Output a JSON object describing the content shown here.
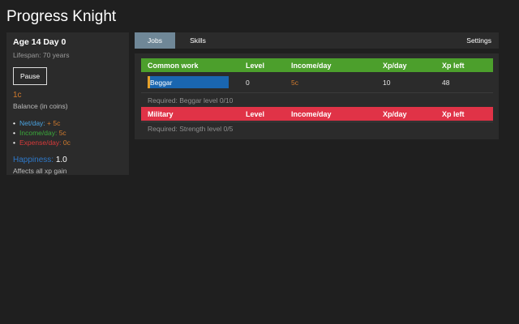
{
  "app": {
    "title": "Progress Knight"
  },
  "sidebar": {
    "age": "Age 14 Day 0",
    "lifespan": "Lifespan: 70 years",
    "pause_label": "Pause",
    "balance": {
      "value": "1c",
      "label": "Balance (in coins)"
    },
    "money": {
      "net_label": "Net/day:",
      "net_value": "+ 5c",
      "income_label": "Income/day:",
      "income_value": "5c",
      "expense_label": "Expense/day:",
      "expense_value": "0c"
    },
    "happiness": {
      "label": "Happiness:",
      "value": "1.0",
      "note": "Affects all xp gain"
    }
  },
  "tabs": {
    "jobs": "Jobs",
    "skills": "Skills",
    "settings": "Settings",
    "active": "Jobs"
  },
  "job_table": {
    "columns": [
      "Level",
      "Income/day",
      "Xp/day",
      "Xp left"
    ],
    "groups": [
      {
        "name": "Common work",
        "color": "#4c9f2c",
        "rows": [
          {
            "name": "Beggar",
            "level": "0",
            "income": "5c",
            "xp_day": "10",
            "xp_left": "48",
            "progress": 0.03
          }
        ],
        "required": "Required: Beggar level 0/10"
      },
      {
        "name": "Military",
        "color": "#e03347",
        "rows": [],
        "required": "Required: Strength level 0/5"
      }
    ]
  },
  "colors": {
    "coin": "#d07a2d",
    "bar_blue": "#1a66b0",
    "bar_fill": "#e6a12a",
    "panel": "#2b2b2b",
    "background": "#1f1f1f"
  }
}
